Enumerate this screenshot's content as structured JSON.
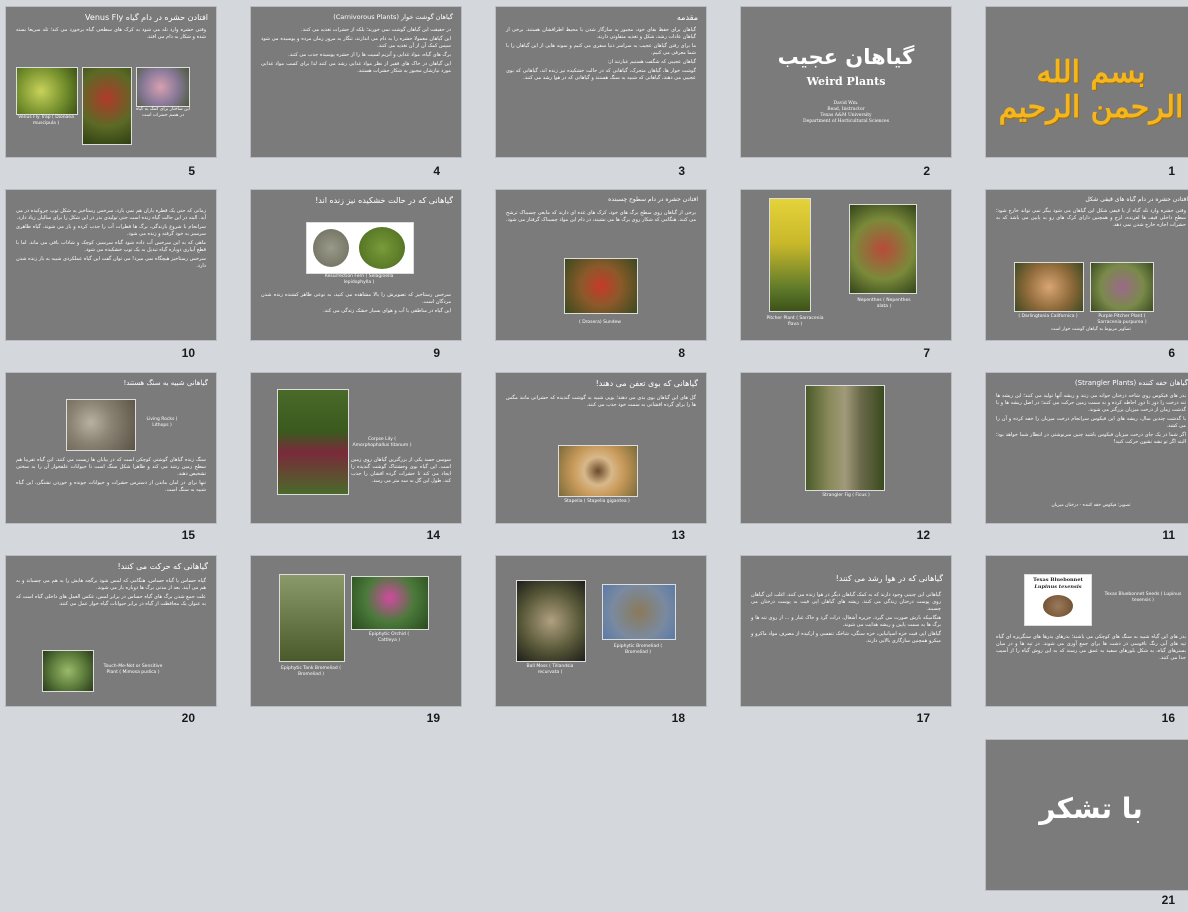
{
  "slides": [
    {
      "n": "1",
      "title": "بسم الله الرحمن الرحيم"
    },
    {
      "n": "2",
      "title": "گیاهان عجیب",
      "subtitle": "Weird Plants",
      "credits": [
        "David Wm.",
        "Bead, Instructor",
        "Texas A&M University",
        "Department of Horticultural Sciences"
      ]
    },
    {
      "n": "3",
      "title": "مقدمه",
      "bullets": [
        "گیاهان برای حفظ بقای خود، مجبور به سازگار شدن با محیط اطرافشان هستند. برخی از گیاهان عادات رشد، شکل و تغذیه متفاوتی دارند.",
        "ما برای رفتن گیاهان عجیب به سراسر دنیا سفری می کنیم و نمونه هایی از این گیاهان را با شما معرفی می کنیم.",
        "گیاهان عجیبی که شگفت هستیم عبارتند از:",
        "گوشت خوار ها، گیاهان متحرک، گیاهانی که در حالت خشکیده نیز زنده اند، گیاهانی که بوی عجیبی می دهند، گیاهانی که شبیه به سنگ هستند و گیاهانی که در هوا رشد می کنند."
      ]
    },
    {
      "n": "4",
      "title": "گیاهان گوشت خوار (Carnivorous Plants)",
      "bullets": [
        "در حقیقت این گیاهان گوشت نمی خورند؛ بلکه از حشرات تغذیه می کنند.",
        "این گیاهان معمولا حشره را به دام می اندازند، تنگار به مرور زمان مرده و پوسیده می شود سپس کمک آن از آن تغذیه می کنند.",
        "برگ های گیاه، مواد غذایی و آنزیم لسیت ها را از حشره پوسیده جذب می کنند.",
        "این گیاهان در خاک های فقیر از نظر مواد غذایی رشد می کنند لذا برای کسب مواد غذایی مورد نیازشان مجبور به شکار حشرات هستند."
      ]
    },
    {
      "n": "5",
      "title": "افتادن حشره در دام گیاه Venus Fly",
      "bullets": [
        "وقتی حشره وارد تله می شود به کرک های سطحی گیاه برخورد می کند؛ تله سریعا بسته شده و شکار به دام می افتد."
      ],
      "captions": [
        "Venus Fly Trap ( Dionaea muscipula )",
        "این ساختار برای کمک به گیاه در هضم حشرات است"
      ]
    },
    {
      "n": "6",
      "title": "افتادن حشره در دام گیاه های قیفی شکل",
      "bullets": [
        "وقتی حشره وارد تله گیاه از یا قیفی شکل این گیاهان می شود بیگر نمی تواند خارج شود؛ سطح داخلی قیف ها لغزنده، لزج و همچنین دارای کرک های رو به پایین می باشد که به حشرات اجازه خارج شدن نمی دهد."
      ],
      "captions": [
        "( Darlingtonia Californica )",
        "Purple Pitcher Plant ( Sarracenia purpurea )",
        "تصاویر مربوط به گیاهان گوشت خوار است"
      ]
    },
    {
      "n": "7",
      "captions": [
        "Pitcher Plant ( Sarracenia flava )",
        "Nepenthes ( Nepenthes alata )"
      ]
    },
    {
      "n": "8",
      "title": "افتادن حشره در دام سطوح چسبنده",
      "bullets": [
        "برخی از گیاهان روی سطح برگ های خود، کرک های غده ای دارند که مایعی چسبناک ترشح می کنند. هنگامی که شکار روی برگ ها می نشیند، در دام این مواد چسبناک گرفتار می شود."
      ],
      "captions": [
        "( Drosera) Sundew"
      ]
    },
    {
      "n": "9",
      "title": "گیاهانی که در حالت خشکیده نیز زنده اند!",
      "bullets": [
        "سرخس رستاخیز که تصویرش را بالا مشاهده می کنید، به نوعی ظاهر کشنده زنده شدن مردگان است.",
        "این گیاه در مناطقی با آب و هوای بسیار خشک زندگی می کند."
      ],
      "captions": [
        "Resurrection Fern ( Selaginella lepidophylla )"
      ]
    },
    {
      "n": "10",
      "bullets": [
        "زمانی که حتی یک قطره باران هم نمی بارد، سرخس رستاخیز به شکل توپ چروکیده در می آید. البته در این حالت گیاه زنده است حتی تولیدی بذر در این شکل را برای سالیان زیاد دارد.",
        "سرانجام با شروع بارندگی، برگ ها قطرات آب را جذب کرده و باز می شوند. گیاه ظاهری سرسبز به خود گرفته و زنده می شود.",
        "ماهی که به این سرخس آب داده شود گیاه سرسبز، کوچک و شاداب باقی می ماند. اما با قطع آبیاری دوباره گیاه تبدیل به یک توپ خشکیده می شود.",
        "سرخس رستاخیز هیچگاه نمی میرد! می توان گفت این گیاه عملکردی شبیه به باز زنده شدن دارد."
      ]
    },
    {
      "n": "11",
      "title": "گیاهان خفه کننده (Strangler Plants)",
      "bullets": [
        "بذر های فیکوس روی شاخه درختان جوانه می زنند و ریشه آنها تولید می کنند؛ این ریشه ها تنه درخت را دور تا دور احاطه کرده و به سمت زمین حرکت می کنند؛ در اصل ریشه ها و با گذشت زمان از درخت میزبان بزرگتر می شوند.",
        "با گذشت چندین سال، ریشه های این فیکوس سرانجام درخت میزبان را خفه کرده و آن را می کشد.",
        "اگر شما در یک جای درخت میزبان فیکوس باشید چنین سرنوشتی در انتظار شما خواهد بود؛ البته اگر تو نشه نشون حرکت کنید!"
      ],
      "captions": [
        "تصویر: فیکوس خفه کننده - درختان میزبان"
      ]
    },
    {
      "n": "12",
      "captions": [
        "Strangler Fig ( Ficus )"
      ]
    },
    {
      "n": "13",
      "title": "گیاهانی که بوی تعفن می دهند!",
      "bullets": [
        "گل های این گیاهان بوی بدی می دهند؛ بویی شبیه به گوشت گندیده که حشراتی مانند مگس ها را برای گرده افشانی به سمت خود جذب می کنند."
      ],
      "captions": [
        "Stapelia ( Stapelia gigantea )"
      ]
    },
    {
      "n": "14",
      "bullets": [
        "سوسن جسد یکی از بزرگترین گیاهان روی زمین است. این گیاه بوی وحشتناک گوشت گندیده را ایجاد می کند تا حشرات گرده افشان را جذب کند. طول این گل به سه متر می رسد."
      ],
      "captions": [
        "Corpse Lily ( Amorphophallus titanum )"
      ]
    },
    {
      "n": "15",
      "title": "گیاهانی شبیه به سنگ هستند!",
      "bullets": [
        "سنگ زنده گیاهان گوشتی کوچکی است که در بیابان ها زیست می کنند. این گیاه تقریبا هم سطح زمین رشد می کند و ظاهرا شکل سنگ است تا حیوانات علفخوار آن را به سختی تشخیص دهند.",
        "تنها برای در امان ماندن از دسترس حشرات و حیوانات جونده و خوردن تشنگی، این گیاه شبیه به سنگ است."
      ],
      "captions": [
        "Living Rocks ( Lithops )"
      ]
    },
    {
      "n": "16",
      "bullets": [
        "بذر های این گیاه شبیه به سنگ های کوچکی می باشند؛ بذرهای بذرها های سنگریزه ای گیاه تپه های آبی رنگ ناقوسی در دشت ها برای جمع آوری می شوند. در تپه ها و در میان بسترهای گیاه، به شکل بلورهای سفید به عمق می رسند که به این روش گیاه را از آسیب جدا می کنند."
      ],
      "captions": [
        "Texas Bluebonnet",
        "Lupinus texensis",
        "Texas Bluebonnet Seeds ( Lupinus texensis )"
      ]
    },
    {
      "n": "17",
      "title": "گیاهانی که در هوا رشد می کنند!",
      "bullets": [
        "گیاهانی این چنینی وجود دارند که به کمک گیاهان دیگر در هوا زنده می کنند. اغلب این گیاهان روی پوست درختان زندگی می کنند. ریشه های گیاهان اپی فیت به پوست درختان می چسبند.",
        "هنگامیکه بارش صورت می گیرد، جزیره آشغال، ذرات گرد و خاک غبار و ... از روی تنه ها و برگ ها به سمت پایین و ریشه هدایت می شوند.",
        "گیاهان اپی فیت خزه اسپانیایی، خزه سنگی، شاخک تنفسی و ارکیده از مصرف مواد ماکرو و میکرو همچنین سازگاری بالایی دارند."
      ]
    },
    {
      "n": "18",
      "captions": [
        "Ball Moss ( Tillandsia recurvata )",
        "Epiphytic Bromeliad ( Bromeliad )"
      ]
    },
    {
      "n": "19",
      "captions": [
        "Epiphytic Orchid ( Cattleya )",
        "Epiphytic Tank Bromeliad ( Bromeliad )"
      ]
    },
    {
      "n": "20",
      "title": "گیاهانی که حرکت می کنند!",
      "bullets": [
        "گیاه حساس یا گیاه حساس، هنگامی که لمس شود برگچه هایش را به هم می چسباند و به هم می آیند. بعد از مدتی برگ ها دوباره باز می شوند.",
        "علت جمع شدن برگ های گیاه حساس در برابر لمس، عکس العمل های داخلی گیاه است که به عنوان یک محافظت از گیاه در برابر حیوانات گیاه خوار عمل می کنند."
      ],
      "captions": [
        "Touch-Me-Not or Sensitive Plant ( Mimosa pudica )"
      ]
    },
    {
      "n": "21",
      "title": "با تشکر"
    }
  ]
}
